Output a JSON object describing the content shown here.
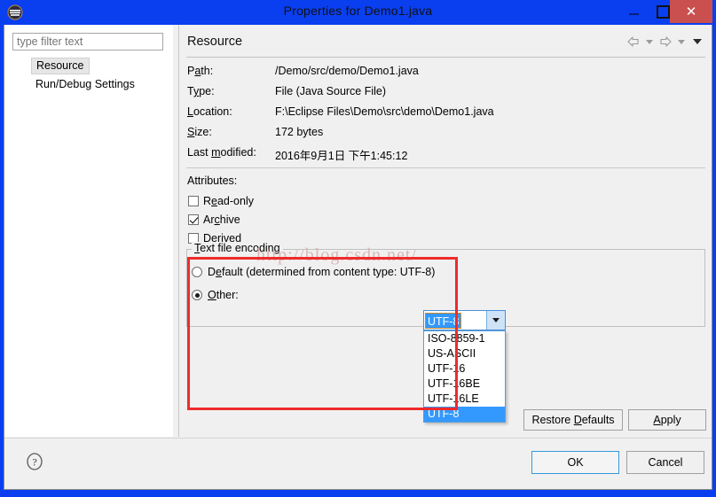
{
  "window": {
    "title": "Properties for Demo1.java",
    "app_icon": "eclipse-icon",
    "accent_color": "#0a3ff0",
    "controls": {
      "minimize": "minimize-icon",
      "maximize": "maximize-icon",
      "close": "close-icon",
      "close_bg": "#c9504f"
    }
  },
  "sidebar": {
    "filter": {
      "placeholder": "type filter text",
      "value": ""
    },
    "items": [
      {
        "label": "Resource",
        "selected": true
      },
      {
        "label": "Run/Debug Settings",
        "selected": false
      }
    ]
  },
  "page": {
    "title": "Resource",
    "nav": {
      "back": "back-arrow-icon",
      "back_menu": "chevron-down-icon",
      "forward": "forward-arrow-icon",
      "forward_menu": "chevron-down-icon",
      "view_menu": "chevron-down-icon"
    },
    "properties": [
      {
        "label_pre": "P",
        "label_mn": "a",
        "label_post": "th:",
        "value": "/Demo/src/demo/Demo1.java"
      },
      {
        "label_pre": "T",
        "label_mn": "y",
        "label_post": "pe:",
        "value": "File  (Java Source File)"
      },
      {
        "label_pre": "",
        "label_mn": "L",
        "label_post": "ocation:",
        "value": "F:\\Eclipse Files\\Demo\\src\\demo\\Demo1.java"
      },
      {
        "label_pre": "",
        "label_mn": "S",
        "label_post": "ize:",
        "value": "172  bytes"
      },
      {
        "label_pre": "Last ",
        "label_mn": "m",
        "label_post": "odified:",
        "value": "2016年9月1日 下午1:45:12"
      }
    ],
    "attributes": {
      "label": "Attributes:",
      "checkboxes": [
        {
          "pre": "R",
          "mn": "e",
          "post": "ad-only",
          "checked": false
        },
        {
          "pre": "Ar",
          "mn": "c",
          "post": "hive",
          "checked": true
        },
        {
          "pre": "Deri",
          "mn": "v",
          "post": "ed",
          "checked": false
        }
      ]
    },
    "encoding": {
      "legend_pre": "",
      "legend_mn": "T",
      "legend_post": "ext file encoding",
      "default_option": {
        "pre": "D",
        "mn": "e",
        "post": "fault (determined from content type: UTF-8)",
        "selected": false
      },
      "other_option": {
        "pre": "",
        "mn": "O",
        "post": "ther:",
        "selected": true
      },
      "combo": {
        "value": "UTF-8",
        "arrow": "chevron-down-icon",
        "expanded": true,
        "options": [
          {
            "label": "ISO-8859-1",
            "selected": false
          },
          {
            "label": "US-ASCII",
            "selected": false
          },
          {
            "label": "UTF-16",
            "selected": false
          },
          {
            "label": "UTF-16BE",
            "selected": false
          },
          {
            "label": "UTF-16LE",
            "selected": false
          },
          {
            "label": "UTF-8",
            "selected": true
          }
        ]
      }
    },
    "buttons": {
      "restore_pre": "Restore ",
      "restore_mn": "D",
      "restore_post": "efaults",
      "apply_pre": "",
      "apply_mn": "A",
      "apply_post": "pply"
    }
  },
  "footer": {
    "help": "help-icon",
    "ok": "OK",
    "cancel": "Cancel"
  },
  "annotation": {
    "rect_color": "#ef2b2b"
  },
  "watermark": {
    "text": "http://blog.csdn.net/"
  }
}
